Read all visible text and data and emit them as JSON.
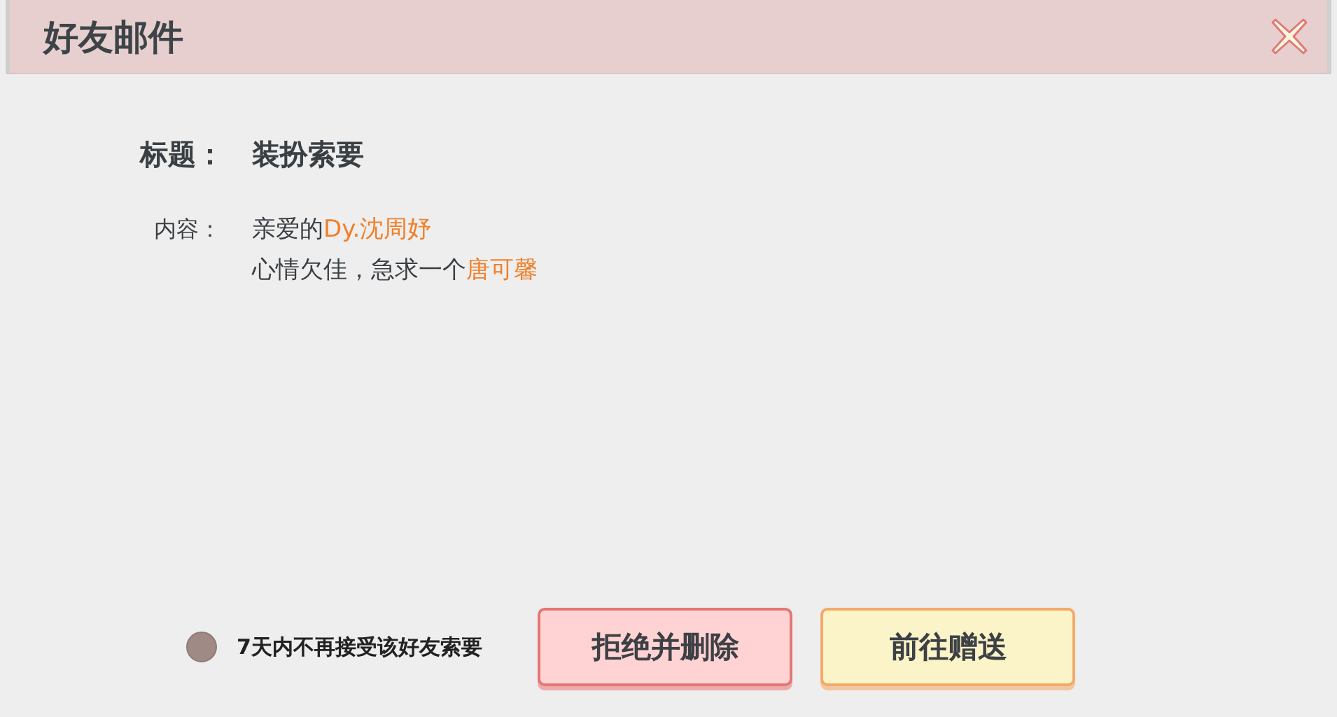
{
  "window": {
    "title": "好友邮件"
  },
  "subject": {
    "label": "标题：",
    "value": "装扮索要"
  },
  "content": {
    "label": "内容：",
    "lines": [
      [
        {
          "text": "亲爱的",
          "highlight": false
        },
        {
          "text": "Dy.沈周妤",
          "highlight": true
        }
      ],
      [
        {
          "text": "心情欠佳，急求一个",
          "highlight": false
        },
        {
          "text": "唐可馨",
          "highlight": true
        }
      ]
    ]
  },
  "option": {
    "label": "7天内不再接受该好友索要",
    "checked": false
  },
  "buttons": [
    {
      "label": "拒绝并删除",
      "kind": "reject"
    },
    {
      "label": "前往赠送",
      "kind": "gift"
    }
  ]
}
